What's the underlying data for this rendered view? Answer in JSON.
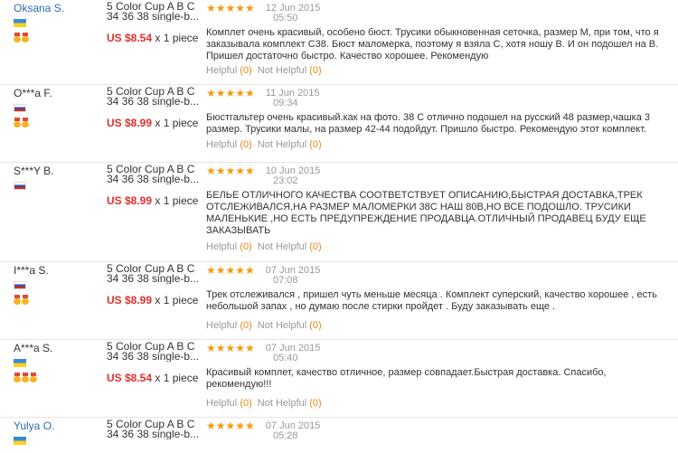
{
  "reviews": [
    {
      "user": "Oksana S.",
      "user_link": true,
      "country": "Ukraine",
      "flag_icon": "ukraine-flag-icon",
      "medals": 2,
      "product_line1": "5 Color Cup A B C",
      "product_line2": "34 36 38 single-b...",
      "price": "US $8.54",
      "qty": "x 1 piece",
      "stars": "★★★★★",
      "date": "12 Jun 2015",
      "time": "05:50",
      "text": "Комплет очень красивый, особено бюст. Трусики обыкновенная сеточка, размер M, при том, что я заказывала комплект С38. Бюст маломерка, поэтому я взяла С, хотя ношу В. И он подошел на В. Пришел достаточно быстро. Качество хорошее. Рекомендую",
      "helpful": "Helpful",
      "helpful_count": "(0)",
      "not_helpful": "Not Helpful",
      "not_helpful_count": "(0)"
    },
    {
      "user": "O***a F.",
      "user_link": false,
      "country": "Russia",
      "flag_icon": "russia-flag-icon",
      "medals": 2,
      "product_line1": "5 Color Cup A B C",
      "product_line2": "34 36 38 single-b...",
      "price": "US $8.99",
      "qty": "x 1 piece",
      "stars": "★★★★★",
      "date": "11 Jun 2015",
      "time": "09:34",
      "text": "Бюстгальтер очень красивый.как на фото. 38 С отлично подошел на русский 48 размер,чашка 3 размер. Трусики малы, на размер 42-44 подойдут. Пришло быстро. Рекомендую этот комплект.",
      "helpful": "Helpful",
      "helpful_count": "(0)",
      "not_helpful": "Not Helpful",
      "not_helpful_count": "(0)"
    },
    {
      "user": "S***Y B.",
      "user_link": false,
      "country": "Russia",
      "flag_icon": "russia-flag-icon",
      "medals": 0,
      "product_line1": "5 Color Cup A B C",
      "product_line2": "34 36 38 single-b...",
      "price": "US $8.99",
      "qty": "x 1 piece",
      "stars": "★★★★★",
      "date": "10 Jun 2015",
      "time": "23:02",
      "text": "БЕЛЬЕ ОТЛИЧНОГО КАЧЕСТВА СООТВЕТСТВУЕТ ОПИСАНИЮ,БЫСТРАЯ ДОСТАВКА,ТРЕК ОТСЛЕЖИВАЛСЯ,НА РАЗМЕР МАЛОМЕРКИ 38С НАШ 80В,НО ВСЕ ПОДОШЛО. ТРУСИКИ МАЛЕНЬКИЕ ,НО ЕСТЬ ПРЕДУПРЕЖДЕНИЕ ПРОДАВЦА.ОТЛИЧНЫЙ ПРОДАВЕЦ БУДУ ЕЩЕ ЗАКАЗЫВАТЬ",
      "helpful": "Helpful",
      "helpful_count": "(0)",
      "not_helpful": "Not Helpful",
      "not_helpful_count": "(0)"
    },
    {
      "user": "I***a S.",
      "user_link": false,
      "country": "Russia",
      "flag_icon": "russia-flag-icon",
      "medals": 2,
      "product_line1": "5 Color Cup A B C",
      "product_line2": "34 36 38 single-b...",
      "price": "US $8.99",
      "qty": "x 1 piece",
      "stars": "★★★★★",
      "date": "07 Jun 2015",
      "time": "07:08",
      "text": "Трек отслеживался , пришел чуть меньше месяца . Комплект суперский, качество хорошее , есть небольшой запах , но думаю после стирки пройдет . Буду заказывать еще .",
      "helpful": "Helpful",
      "helpful_count": "(0)",
      "not_helpful": "Not Helpful",
      "not_helpful_count": "(0)"
    },
    {
      "user": "A***a S.",
      "user_link": false,
      "country": "Ukraine",
      "flag_icon": "ukraine-flag-icon",
      "medals": 3,
      "product_line1": "5 Color Cup A B C",
      "product_line2": "34 36 38 single-b...",
      "price": "US $8.54",
      "qty": "x 1 piece",
      "stars": "★★★★★",
      "date": "07 Jun 2015",
      "time": "05:40",
      "text": "Красивый комплет, качество отличное, размер совпадает.Быстрая доставка. Спасибо, рекомендую!!!",
      "helpful": "Helpful",
      "helpful_count": "(0)",
      "not_helpful": "Not Helpful",
      "not_helpful_count": "(0)"
    },
    {
      "user": "Yulya O.",
      "user_link": true,
      "country": "Ukraine",
      "flag_icon": "ukraine-flag-icon",
      "medals": 0,
      "product_line1": "5 Color Cup A B C",
      "product_line2": "34 36 38 single-b...",
      "price": "",
      "qty": "",
      "stars": "★★★★★",
      "date": "07 Jun 2015",
      "time": "05:28",
      "text": "",
      "helpful": "",
      "helpful_count": "",
      "not_helpful": "",
      "not_helpful_count": ""
    }
  ]
}
